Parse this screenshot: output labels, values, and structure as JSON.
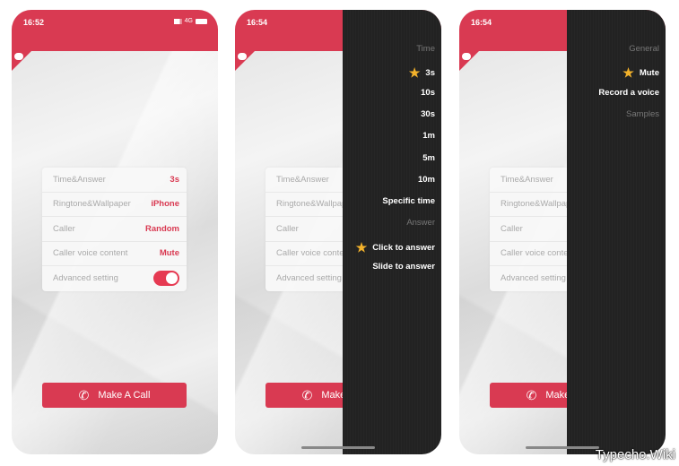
{
  "colors": {
    "accent": "#d93a52",
    "drawer": "#222222",
    "star": "#f3b22b"
  },
  "status": {
    "network": "4G",
    "times": [
      "16:52",
      "16:54",
      "16:54"
    ]
  },
  "settings": [
    {
      "label": "Time&Answer",
      "value": "3s"
    },
    {
      "label": "Ringtone&Wallpaper",
      "value": "iPhone"
    },
    {
      "label": "Caller",
      "value": "Random"
    },
    {
      "label": "Caller voice content",
      "value": "Mute"
    },
    {
      "label": "Advanced setting",
      "toggle": true
    }
  ],
  "make_call": "Make A Call",
  "drawer_time": {
    "items": [
      {
        "text": "Time",
        "header": true
      },
      {
        "text": "3s",
        "selected": true
      },
      {
        "text": "10s"
      },
      {
        "text": "30s"
      },
      {
        "text": "1m"
      },
      {
        "text": "5m"
      },
      {
        "text": "10m"
      },
      {
        "text": "Specific time"
      },
      {
        "text": "Answer",
        "header": true
      },
      {
        "text": "Click to answer",
        "selected": true
      },
      {
        "text": "Slide to answer"
      }
    ]
  },
  "drawer_voice": {
    "items": [
      {
        "text": "General",
        "header": true
      },
      {
        "text": "Mute",
        "selected": true
      },
      {
        "text": "Record a voice"
      },
      {
        "text": "Samples",
        "header": true
      }
    ]
  },
  "watermark": "Typecho.Wiki"
}
